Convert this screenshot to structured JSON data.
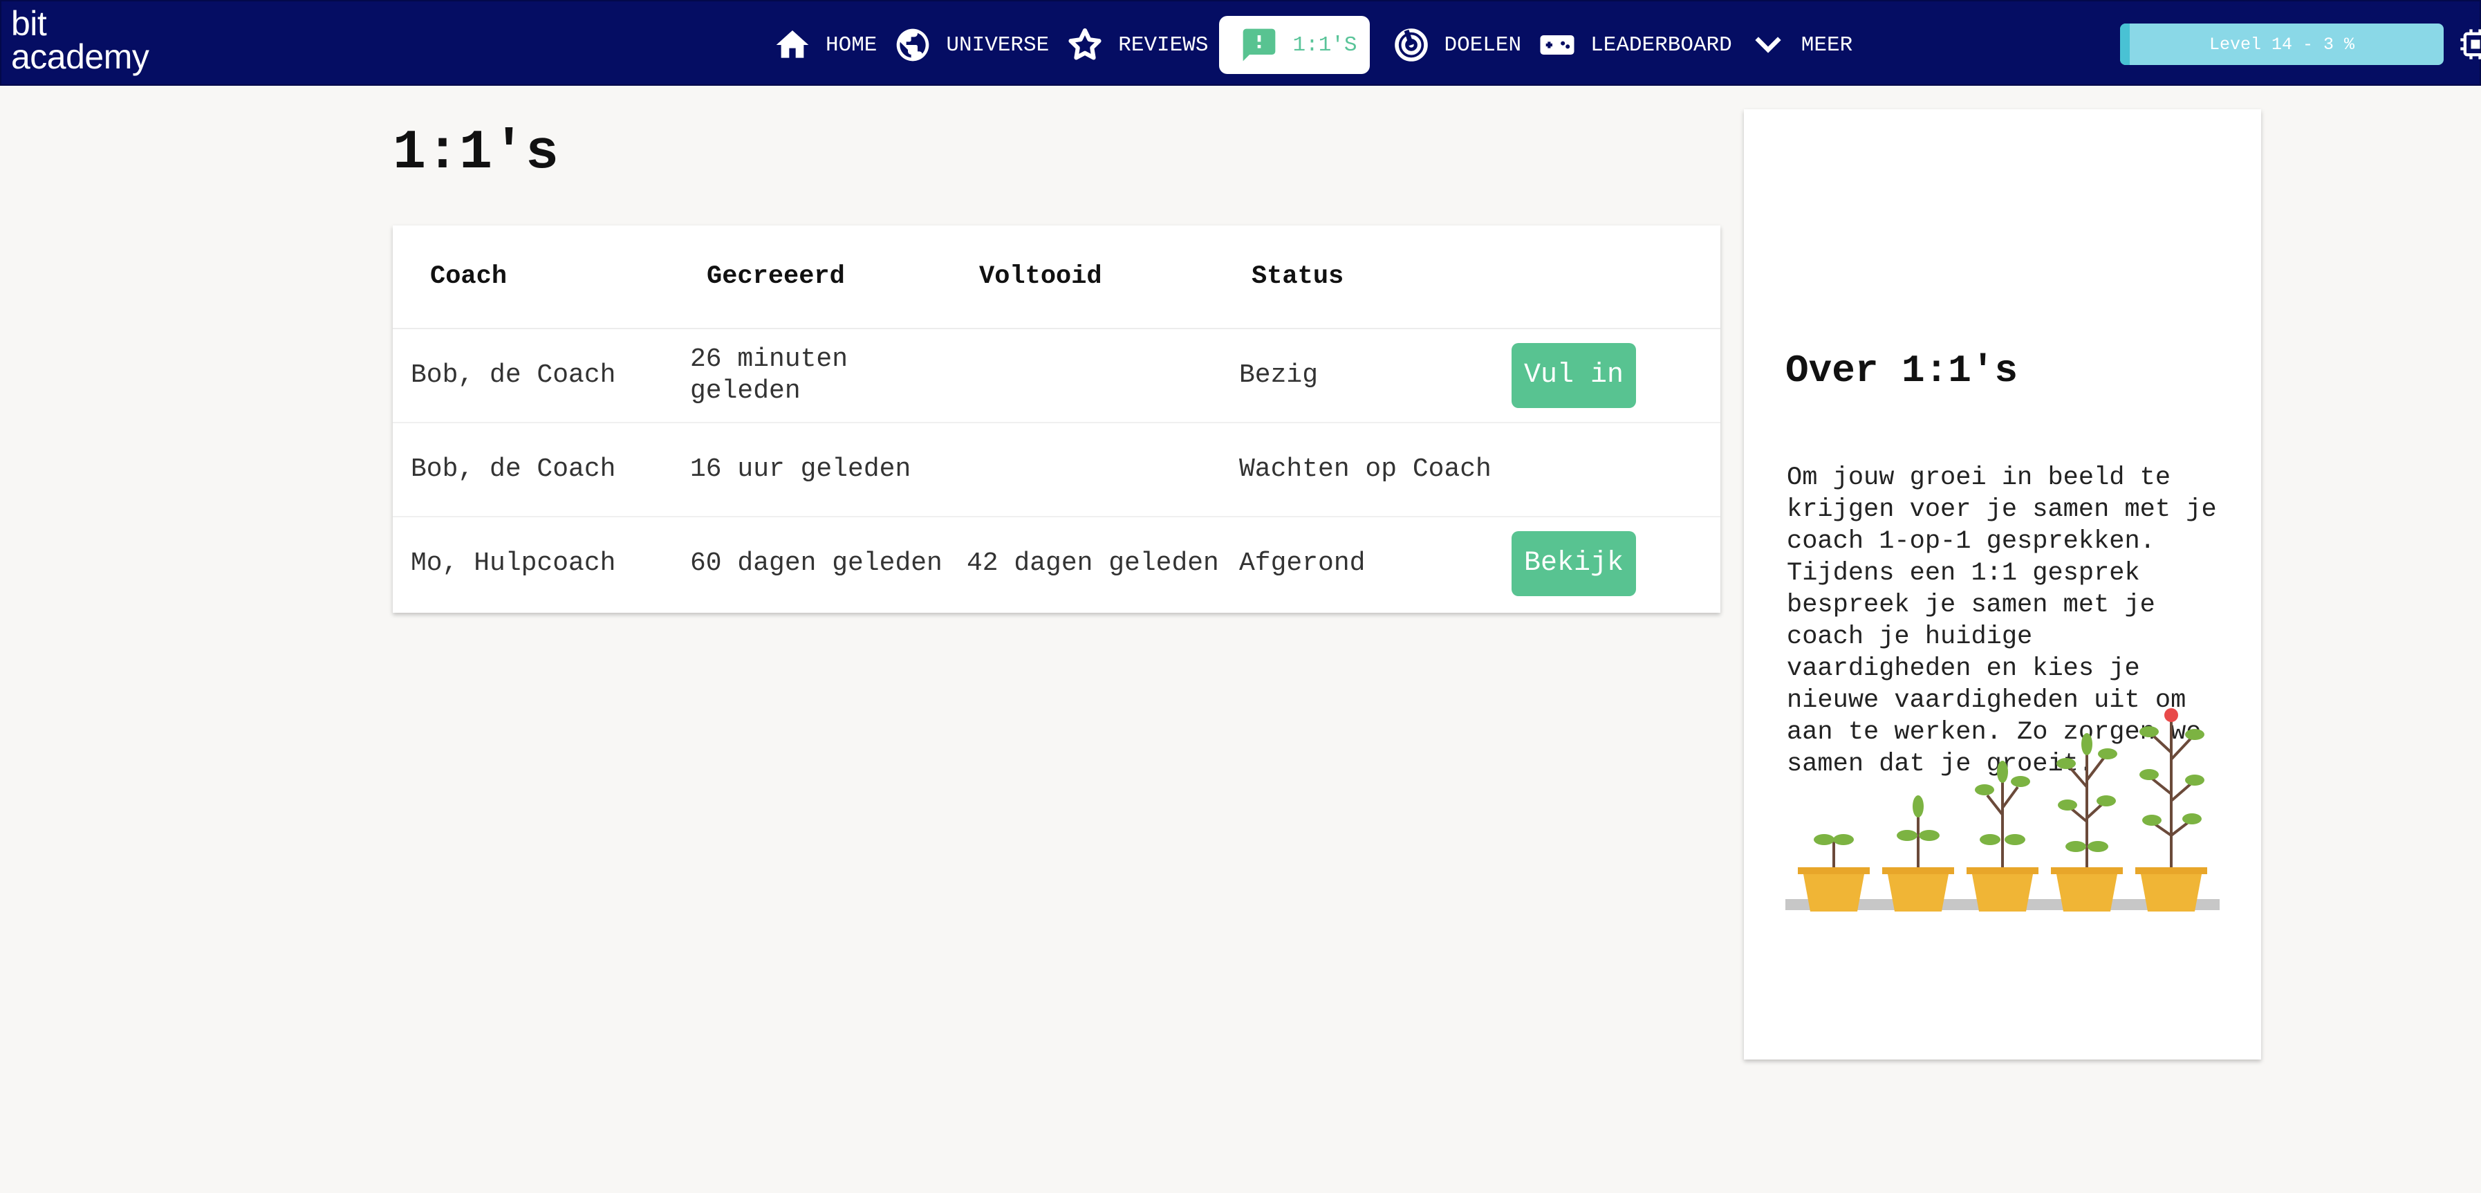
{
  "logo": {
    "line1": "bit",
    "line2": "academy"
  },
  "nav": {
    "items": [
      {
        "label": "HOME",
        "icon": "home-icon"
      },
      {
        "label": "UNIVERSE",
        "icon": "globe-icon"
      },
      {
        "label": "REVIEWS",
        "icon": "star-icon"
      },
      {
        "label": "1:1'S",
        "icon": "chat-alert-icon",
        "active": true
      },
      {
        "label": "DOELEN",
        "icon": "target-icon"
      },
      {
        "label": "LEADERBOARD",
        "icon": "gamepad-icon"
      },
      {
        "label": "MEER",
        "icon": "chevron-down-icon"
      }
    ],
    "level_text": "Level 14 - 3 %",
    "level_progress": 0.03
  },
  "main": {
    "title": "1:1's",
    "table": {
      "headers": [
        "Coach",
        "Gecreeerd",
        "Voltooid",
        "Status"
      ],
      "rows": [
        {
          "coach": "Bob, de Coach",
          "created": "26 minuten geleden",
          "completed": "",
          "status": "Bezig",
          "action": "Vul in"
        },
        {
          "coach": "Bob, de Coach",
          "created": "16 uur geleden",
          "completed": "",
          "status": "Wachten op Coach",
          "action": ""
        },
        {
          "coach": "Mo, Hulpcoach",
          "created": "60 dagen geleden",
          "completed": "42 dagen geleden",
          "status": "Afgerond",
          "action": "Bekijk"
        }
      ]
    }
  },
  "side": {
    "title": "Over 1:1's",
    "body": "Om jouw groei in beeld te krijgen voer je samen met je coach 1-op-1 gesprekken. Tijdens een 1:1 gesprek bespreek je samen met je coach je huidige vaardigheden en kies je nieuwe vaardigheden uit om aan te werken. Zo zorgen we samen dat je groeit."
  },
  "colors": {
    "nav_bg": "#050d63",
    "accent_green": "#58c391",
    "level_bar": "#8ad8e7",
    "page_bg": "#f8f7f5",
    "pot": "#f0b536"
  }
}
